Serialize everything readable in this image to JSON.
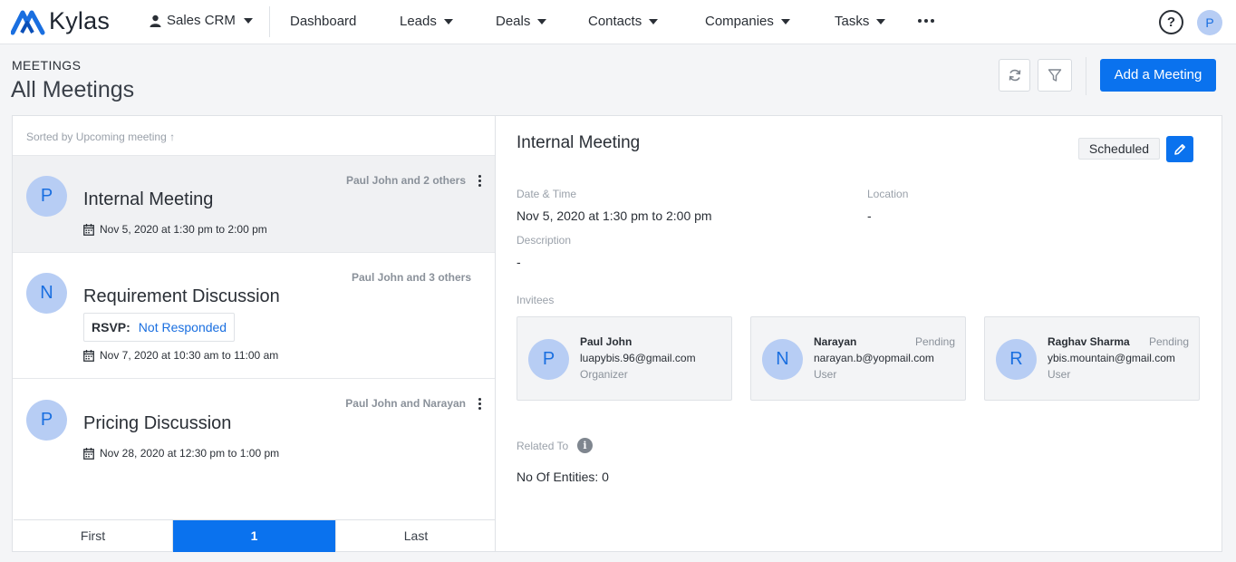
{
  "app": {
    "brand": "Kylas",
    "product": "Sales CRM"
  },
  "nav": {
    "items": [
      "Dashboard",
      "Leads",
      "Deals",
      "Contacts",
      "Companies",
      "Tasks"
    ],
    "user_initial": "P",
    "help_label": "?"
  },
  "header": {
    "section": "MEETINGS",
    "title": "All Meetings",
    "add_button": "Add a Meeting"
  },
  "list": {
    "sort_label": "Sorted by",
    "sort_field": "Upcoming meeting ↑",
    "meetings": [
      {
        "initial": "P",
        "title": "Internal Meeting",
        "participants": "Paul John and 2 others",
        "date": "Nov 5, 2020 at 1:30 pm to 2:00 pm",
        "rsvp": null
      },
      {
        "initial": "N",
        "title": "Requirement Discussion",
        "participants": "Paul John and 3 others",
        "date": "Nov 7, 2020 at 10:30 am to 11:00 am",
        "rsvp_label": "RSVP:",
        "rsvp_value": "Not Responded"
      },
      {
        "initial": "P",
        "title": "Pricing Discussion",
        "participants": "Paul John and Narayan",
        "date": "Nov 28, 2020 at 12:30 pm to 1:00 pm",
        "rsvp": null
      }
    ],
    "pager": {
      "first": "First",
      "current": "1",
      "last": "Last"
    }
  },
  "detail": {
    "title": "Internal Meeting",
    "status": "Scheduled",
    "date_label": "Date & Time",
    "date_value": "Nov 5, 2020 at 1:30 pm to 2:00 pm",
    "location_label": "Location",
    "location_value": "-",
    "description_label": "Description",
    "description_value": "-",
    "invitees_label": "Invitees",
    "invitees": [
      {
        "initial": "P",
        "name": "Paul John",
        "email": "luapybis.96@gmail.com",
        "role": "Organizer",
        "status": ""
      },
      {
        "initial": "N",
        "name": "Narayan",
        "email": "narayan.b@yopmail.com",
        "role": "User",
        "status": "Pending"
      },
      {
        "initial": "R",
        "name": "Raghav Sharma",
        "email": "ybis.mountain@gmail.com",
        "role": "User",
        "status": "Pending"
      }
    ],
    "related_label": "Related To",
    "related_value": "No Of Entities: 0"
  },
  "colors": {
    "primary": "#0a72ee",
    "avatar_bg": "#b7cdf4",
    "avatar_fg": "#1a6fe0"
  }
}
